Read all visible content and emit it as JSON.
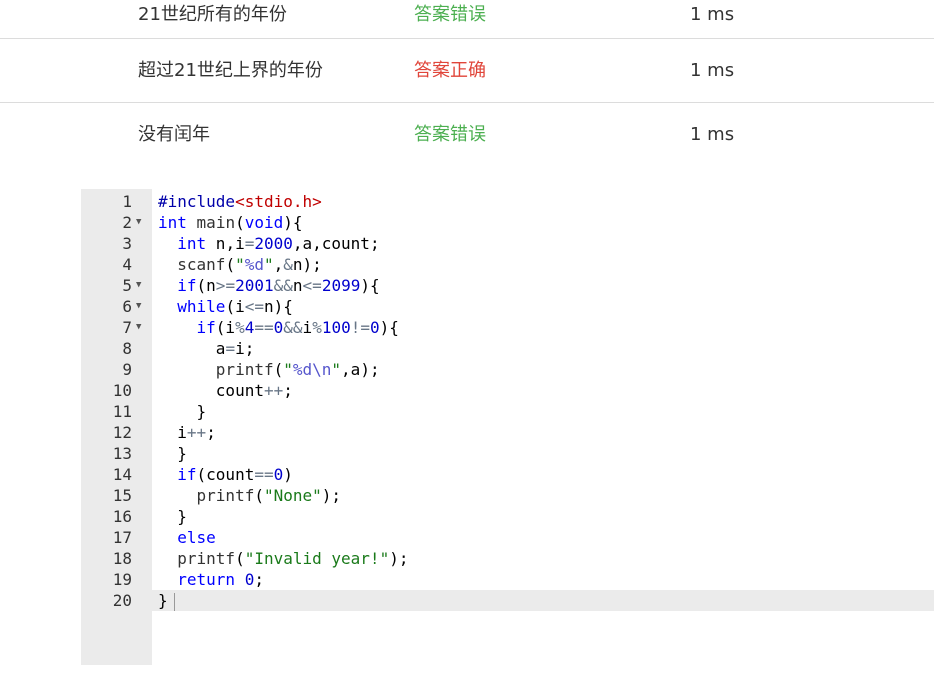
{
  "results": [
    {
      "name": "21世纪所有的年份",
      "status": "答案错误",
      "status_kind": "bad",
      "time": "1 ms"
    },
    {
      "name": "超过21世纪上界的年份",
      "status": "答案正确",
      "status_kind": "ok",
      "time": "1 ms"
    },
    {
      "name": "没有闰年",
      "status": "答案错误",
      "status_kind": "bad",
      "time": "1 ms"
    }
  ],
  "colors": {
    "status_ok": "#e0453a",
    "status_bad": "#4caf50"
  },
  "editor": {
    "active_line": 20,
    "lines": [
      {
        "n": "1",
        "fold": "",
        "code": "#include<stdio.h>"
      },
      {
        "n": "2",
        "fold": "▼",
        "code": "int main(void){"
      },
      {
        "n": "3",
        "fold": "",
        "code": "  int n,i=2000,a,count;"
      },
      {
        "n": "4",
        "fold": "",
        "code": "  scanf(\"%d\",&n);"
      },
      {
        "n": "5",
        "fold": "▼",
        "code": "  if(n>=2001&&n<=2099){"
      },
      {
        "n": "6",
        "fold": "▼",
        "code": "  while(i<=n){"
      },
      {
        "n": "7",
        "fold": "▼",
        "code": "    if(i%4==0&&i%100!=0){"
      },
      {
        "n": "8",
        "fold": "",
        "code": "      a=i;"
      },
      {
        "n": "9",
        "fold": "",
        "code": "      printf(\"%d\\n\",a);"
      },
      {
        "n": "10",
        "fold": "",
        "code": "      count++;"
      },
      {
        "n": "11",
        "fold": "",
        "code": "    }"
      },
      {
        "n": "12",
        "fold": "",
        "code": "  i++;"
      },
      {
        "n": "13",
        "fold": "",
        "code": "  }"
      },
      {
        "n": "14",
        "fold": "",
        "code": "  if(count==0)"
      },
      {
        "n": "15",
        "fold": "",
        "code": "    printf(\"None\");"
      },
      {
        "n": "16",
        "fold": "",
        "code": "  }"
      },
      {
        "n": "17",
        "fold": "",
        "code": "  else"
      },
      {
        "n": "18",
        "fold": "",
        "code": "  printf(\"Invalid year!\");"
      },
      {
        "n": "19",
        "fold": "",
        "code": "  return 0;"
      },
      {
        "n": "20",
        "fold": "",
        "code": "}"
      }
    ]
  }
}
